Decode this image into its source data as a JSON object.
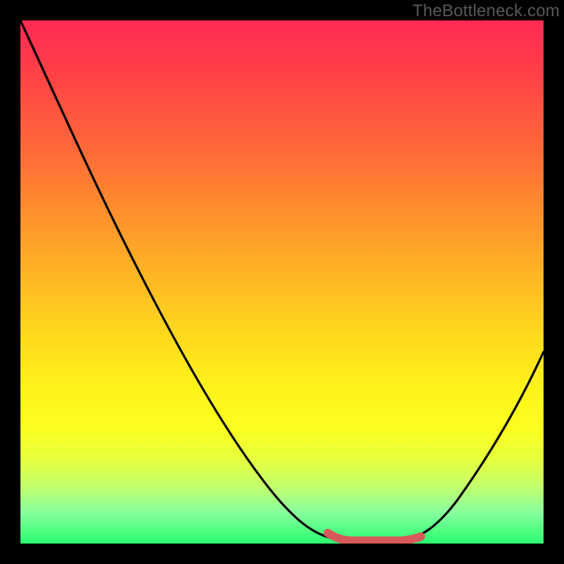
{
  "chart_data": {
    "type": "line",
    "title": "",
    "xlabel": "",
    "ylabel": "",
    "watermark": "TheBottleneck.com",
    "x_range_pct": [
      0,
      100
    ],
    "y_range_pct": [
      0,
      100
    ],
    "series": [
      {
        "name": "bottleneck_curve",
        "color": "#000000",
        "x": [
          0,
          5,
          10,
          15,
          20,
          25,
          30,
          35,
          40,
          45,
          50,
          55,
          58,
          62,
          66,
          70,
          73,
          76,
          80,
          85,
          90,
          95,
          100
        ],
        "y": [
          100,
          92,
          84,
          76,
          67,
          58,
          49,
          40,
          31,
          22,
          14,
          7,
          3,
          1,
          0,
          0,
          0,
          1,
          5,
          13,
          22,
          30,
          37
        ]
      },
      {
        "name": "highlight_range",
        "color": "#d85a5a",
        "x": [
          59,
          62,
          66,
          70,
          73,
          76
        ],
        "y": [
          2,
          1,
          0,
          0,
          0,
          1
        ]
      }
    ],
    "background_gradient": {
      "top": "#ff2a55",
      "mid": "#ffe81c",
      "bottom": "#29fd6e",
      "meaning": "red=high bottleneck, green=low bottleneck"
    },
    "highlight": {
      "x_start_pct": 59,
      "x_end_pct": 76,
      "note": "optimal / no-bottleneck zone"
    }
  }
}
